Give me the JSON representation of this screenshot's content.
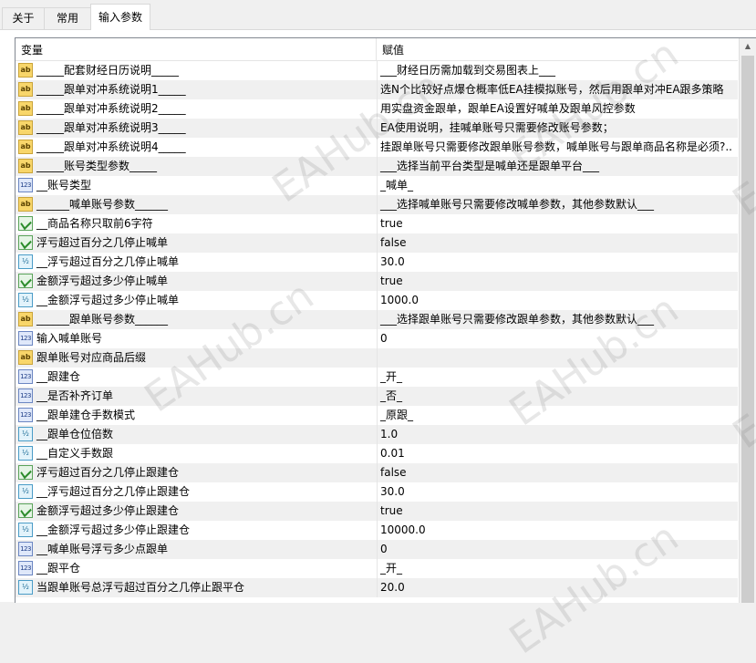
{
  "tabs": [
    {
      "label": "关于"
    },
    {
      "label": "常用"
    },
    {
      "label": "输入参数"
    }
  ],
  "columns": {
    "variable": "变量",
    "value": "赋值"
  },
  "rows": [
    {
      "type": "ab",
      "name": "_____配套财经日历说明_____",
      "value": "___财经日历需加载到交易图表上___"
    },
    {
      "type": "ab",
      "name": "_____跟单对冲系统说明1_____",
      "value": "选N个比较好点爆仓概率低EA挂模拟账号，然后用跟单对冲EA跟多策略"
    },
    {
      "type": "ab",
      "name": "_____跟单对冲系统说明2_____",
      "value": "用实盘资金跟单，跟单EA设置好喊单及跟单风控参数"
    },
    {
      "type": "ab",
      "name": "_____跟单对冲系统说明3_____",
      "value": "EA使用说明，挂喊单账号只需要修改账号参数；"
    },
    {
      "type": "ab",
      "name": "_____跟单对冲系统说明4_____",
      "value": "挂跟单账号只需要修改跟单账号参数，喊单账号与跟单商品名称是必须?.."
    },
    {
      "type": "ab",
      "name": "_____账号类型参数_____",
      "value": "___选择当前平台类型是喊单还是跟单平台___"
    },
    {
      "type": "n123",
      "name": "__账号类型",
      "value": "_喊单_"
    },
    {
      "type": "ab",
      "name": "______喊单账号参数______",
      "value": "___选择喊单账号只需要修改喊单参数，其他参数默认___"
    },
    {
      "type": "bool",
      "name": "__商品名称只取前6字符",
      "value": "true"
    },
    {
      "type": "bool",
      "name": "浮亏超过百分之几停止喊单",
      "value": "false"
    },
    {
      "type": "dbl",
      "name": "__浮亏超过百分之几停止喊单",
      "value": "30.0"
    },
    {
      "type": "bool",
      "name": "金额浮亏超过多少停止喊单",
      "value": "true"
    },
    {
      "type": "dbl",
      "name": "__金额浮亏超过多少停止喊单",
      "value": "1000.0"
    },
    {
      "type": "ab",
      "name": "______跟单账号参数______",
      "value": "___选择跟单账号只需要修改跟单参数，其他参数默认___"
    },
    {
      "type": "n123",
      "name": "输入喊单账号",
      "value": "0"
    },
    {
      "type": "ab",
      "name": "跟单账号对应商品后缀",
      "value": ""
    },
    {
      "type": "n123",
      "name": "__跟建仓",
      "value": "_开_"
    },
    {
      "type": "n123",
      "name": "__是否补齐订单",
      "value": "_否_"
    },
    {
      "type": "n123",
      "name": "__跟单建仓手数模式",
      "value": "_原跟_"
    },
    {
      "type": "dbl",
      "name": "__跟单仓位倍数",
      "value": "1.0"
    },
    {
      "type": "dbl",
      "name": "__自定义手数跟",
      "value": "0.01"
    },
    {
      "type": "bool",
      "name": "浮亏超过百分之几停止跟建仓",
      "value": "false"
    },
    {
      "type": "dbl",
      "name": "__浮亏超过百分之几停止跟建仓",
      "value": "30.0"
    },
    {
      "type": "bool",
      "name": "金额浮亏超过多少停止跟建仓",
      "value": "true"
    },
    {
      "type": "dbl",
      "name": "__金额浮亏超过多少停止跟建仓",
      "value": "10000.0"
    },
    {
      "type": "n123",
      "name": "__喊单账号浮亏多少点跟单",
      "value": "0"
    },
    {
      "type": "n123",
      "name": "__跟平仓",
      "value": "_开_"
    },
    {
      "type": "dbl",
      "name": "当跟单账号总浮亏超过百分之几停止跟平仓",
      "value": "20.0"
    }
  ],
  "icon_text": {
    "ab": "ab",
    "n123": "123",
    "bool": "",
    "dbl": "½"
  },
  "watermarks": [
    "EAHub.cn",
    "EAHub.cn",
    "EAHub.cn",
    "EAHub.cn",
    "EAHub.cn",
    "EAHub.cn",
    "EAHub.cn"
  ]
}
